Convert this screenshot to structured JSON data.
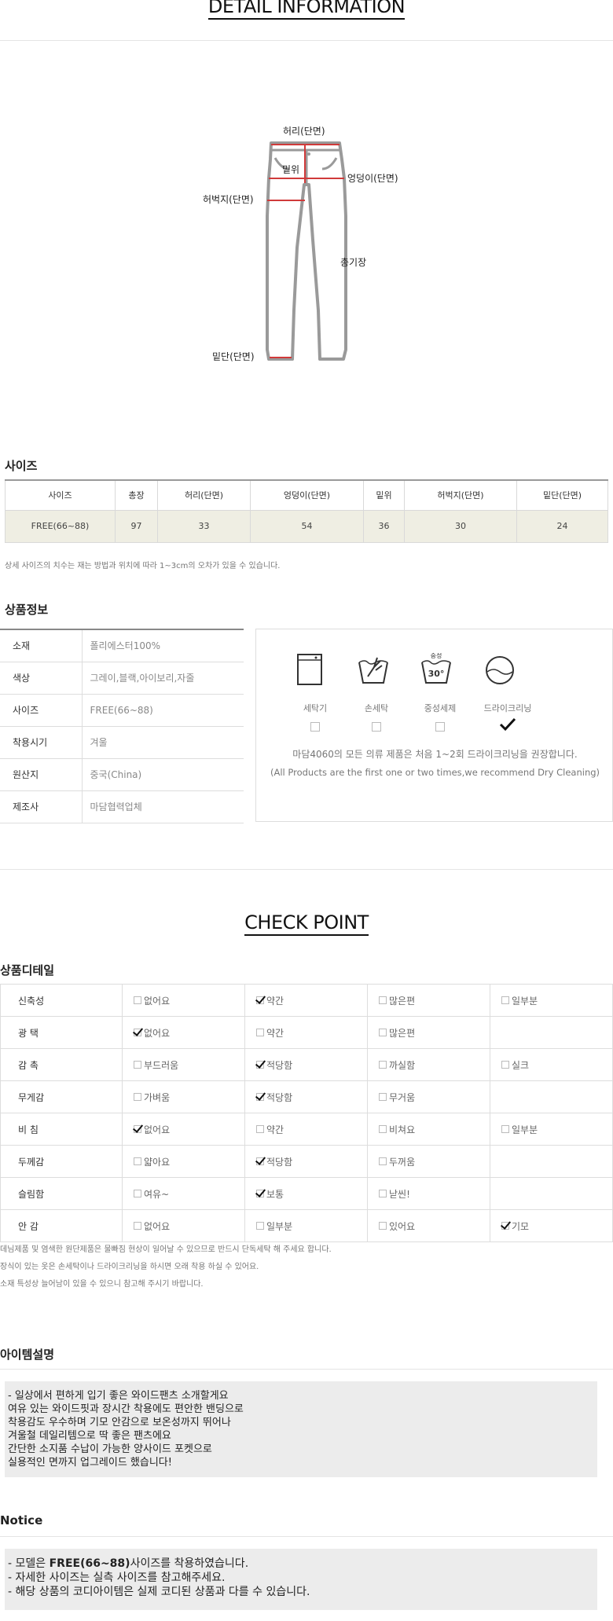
{
  "detail_title": "DETAIL INFORMATION",
  "diagram_labels": {
    "waist": "허리(단면)",
    "rise": "밑위",
    "hip": "엉덩이(단면)",
    "thigh": "허벅지(단면)",
    "length": "총기장",
    "hem": "밑단(단면)"
  },
  "size_section": {
    "title": "사이즈",
    "headers": [
      "사이즈",
      "총장",
      "허리(단면)",
      "엉덩이(단면)",
      "밑위",
      "허벅지(단면)",
      "밑단(단면)"
    ],
    "row": [
      "FREE(66~88)",
      "97",
      "33",
      "54",
      "36",
      "30",
      "24"
    ],
    "note": "상세 사이즈의 치수는 재는 방법과 위치에 따라 1~3cm의 오차가 있을 수 있습니다."
  },
  "product_info": {
    "title": "상품정보",
    "rows": [
      {
        "k": "소재",
        "v": "폴리에스터100%"
      },
      {
        "k": "색상",
        "v": "그레이,블랙,아이보리,자줄"
      },
      {
        "k": "사이즈",
        "v": "FREE(66~88)"
      },
      {
        "k": "착용시기",
        "v": "겨울"
      },
      {
        "k": "원산지",
        "v": "중국(China)"
      },
      {
        "k": "제조사",
        "v": "마담협력업체"
      }
    ],
    "care": {
      "labels": [
        "세탁기",
        "손세탁",
        "중성세제",
        "드라이크리닝"
      ],
      "checked_index": 3,
      "neutral_icon_text": "중성",
      "temp_text": "30°",
      "note_ko": "마담4060의 모든 의류 제품은 처음 1~2회 드라이크리닝을 권장합니다.",
      "note_en": "(All Products are the first one or two times,we recommend Dry Cleaning)"
    }
  },
  "check_point": {
    "title": "CHECK POINT",
    "subtitle": "상품디테일",
    "rows": [
      {
        "k": "신축성",
        "opts": [
          "없어요",
          "약간",
          "많은편",
          "일부분"
        ],
        "on": 1
      },
      {
        "k": "광 택",
        "opts": [
          "없어요",
          "약간",
          "많은편",
          ""
        ],
        "on": 0
      },
      {
        "k": "감 촉",
        "opts": [
          "부드러움",
          "적당함",
          "까실함",
          "실크"
        ],
        "on": 1
      },
      {
        "k": "무게감",
        "opts": [
          "가벼움",
          "적당함",
          "무거움",
          ""
        ],
        "on": 1
      },
      {
        "k": "비 침",
        "opts": [
          "없어요",
          "약간",
          "비쳐요",
          "일부분"
        ],
        "on": 0
      },
      {
        "k": "두께감",
        "opts": [
          "얇아요",
          "적당함",
          "두꺼움",
          ""
        ],
        "on": 1
      },
      {
        "k": "슬림함",
        "opts": [
          "여유~",
          "보통",
          "낟씬!",
          ""
        ],
        "on": 1
      },
      {
        "k": "안 감",
        "opts": [
          "없어요",
          "일부분",
          "있어요",
          "기모"
        ],
        "on": 3
      }
    ],
    "notes": [
      "데님제품 및 염색한 원단제품은 물빠짐 현상이 일어날 수 있으므로 반드시 단독세탁 해 주세요 합니다.",
      "장식이 있는 옷은 손세탁이나 드라이크리닝을 하시면 오래 착용 하실 수 있어요.",
      "소재 특성상 늘어남이 있을 수 있으니 참고해 주시기 바랍니다."
    ]
  },
  "item_desc": {
    "title": "아이템설명",
    "lines": [
      "- 일상에서 편하게 입기 좋은 와이드팬츠 소개할게요",
      "여유 있는 와이드핏과 장시간 착용에도 편안한 밴딩으로",
      "착용감도 우수하며 기모 안감으로 보온성까지 뛰어나",
      "겨울철 데일리템으로 딱 좋은 팬츠에요",
      "간단한 소지품 수납이 가능한 양사이드 포켓으로",
      "실용적인 면까지 업그레이드 했습니다!"
    ]
  },
  "notice": {
    "title": "Notice",
    "line1_prefix": "- 모델은 ",
    "line1_bold": "FREE(66~88)",
    "line1_suffix": "사이즈를 착용하였습니다.",
    "line2": "- 자세한 사이즈는 실측 사이즈를 참고해주세요.",
    "line3": "- 해당 상품의 코디아이템은 실제 코디된 상품과 다를 수 있습니다."
  }
}
